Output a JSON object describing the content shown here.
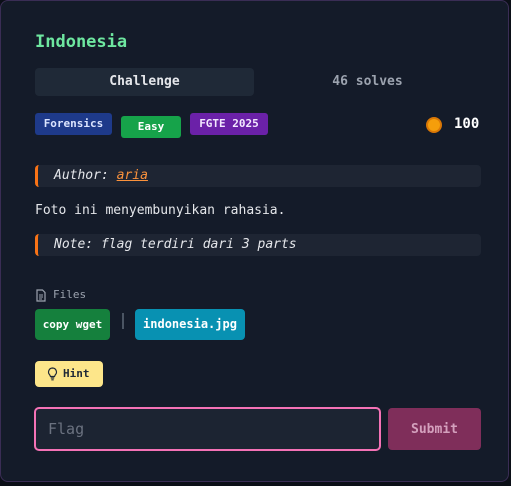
{
  "challenge": {
    "title": "Indonesia",
    "tabs": {
      "challenge": "Challenge",
      "solves": "46 solves"
    },
    "tags": {
      "category": "Forensics",
      "difficulty": "Easy",
      "event": "FGTE 2025"
    },
    "points": "100",
    "author_prefix": "Author: ",
    "author_name": "aria",
    "description": "Foto ini menyembunyikan rahasia.",
    "note": "Note: flag terdiri dari 3 parts",
    "files_label": "Files",
    "copy_wget_label": "copy wget",
    "file_name": "indonesia.jpg",
    "hint_label": "Hint",
    "flag_placeholder": "Flag",
    "submit_label": "Submit"
  },
  "colors": {
    "title": "#6ee7a0",
    "category_tag": "#1e3a8a",
    "difficulty_tag": "#16a34a",
    "event_tag": "#6b21a8",
    "note_accent": "#f97316",
    "wget_button": "#15803d",
    "file_button": "#0891b2",
    "hint_button": "#fde68a",
    "input_border": "#f472b6",
    "submit_button": "#7f2e5a"
  },
  "icons": {
    "points": "coin-icon",
    "files": "file-icon",
    "hint": "lightbulb-icon"
  }
}
